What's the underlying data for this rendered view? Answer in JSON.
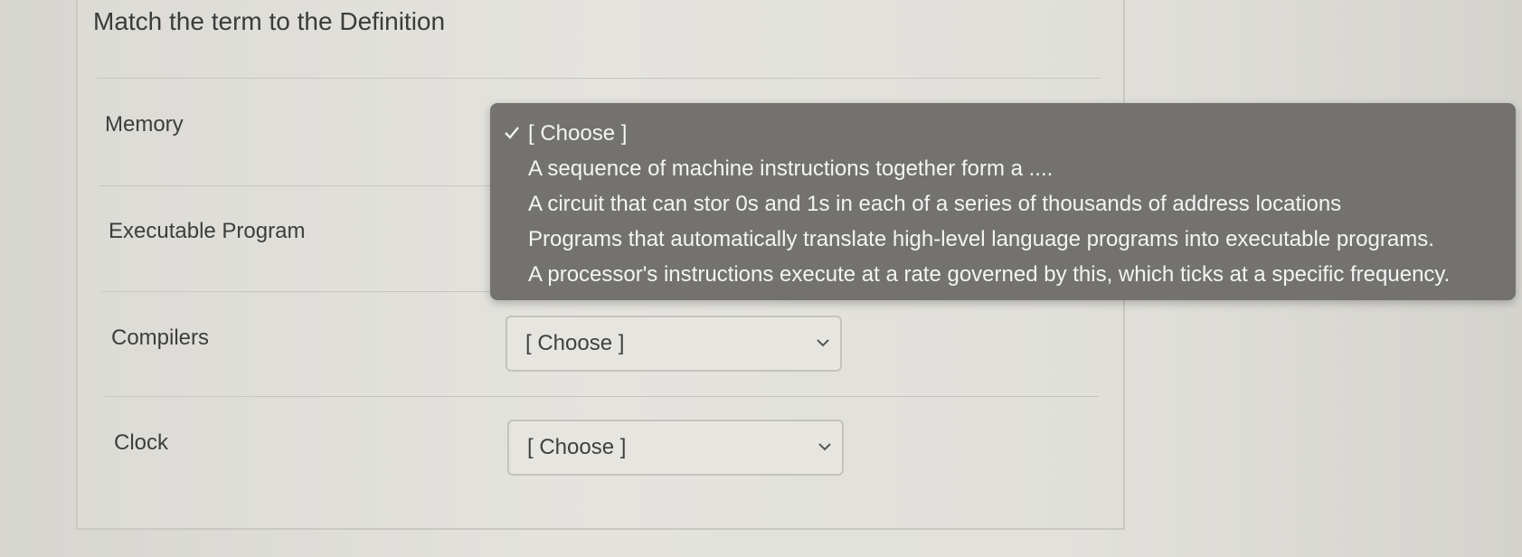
{
  "question": {
    "title": "Match the term to the Definition"
  },
  "terms": [
    {
      "label": "Memory"
    },
    {
      "label": "Executable Program"
    },
    {
      "label": "Compilers"
    },
    {
      "label": "Clock"
    }
  ],
  "selects": {
    "compilers_value": "[ Choose ]",
    "clock_value": "[ Choose ]"
  },
  "dropdown": {
    "options": [
      "[ Choose ]",
      "A sequence of machine instructions together form a ....",
      "A circuit that can stor 0s and 1s in each of a series of thousands of address locations",
      "Programs that automatically translate high-level language programs into executable programs.",
      "A processor's instructions execute at a rate governed by this, which ticks at a specific frequency."
    ],
    "selected_index": 0
  },
  "icons": {
    "check": "check-icon",
    "chevron": "chevron-down-icon"
  },
  "colors": {
    "page_background": "#dcdbd6",
    "dropdown_background": "#706e6b",
    "dropdown_text": "#f4f4f4"
  }
}
